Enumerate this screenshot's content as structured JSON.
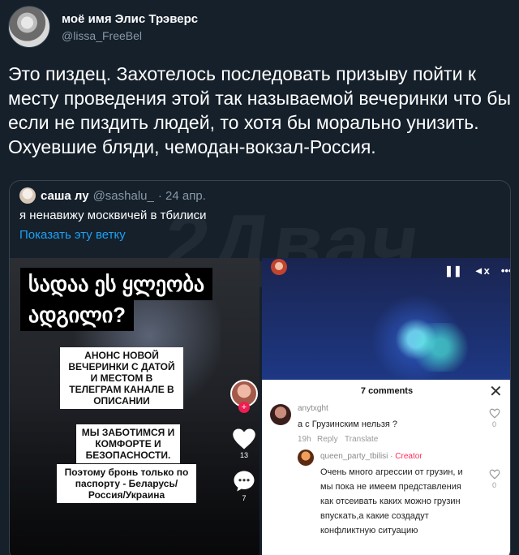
{
  "author": {
    "display_name": "моё имя Элис Трэверс",
    "handle": "@lissa_FreeBel"
  },
  "tweet": {
    "text": "Это пиздец. Захотелось последовать призыву пойти к месту проведения этой так называемой вечеринки что бы если не пиздить людей, то хотя бы морально унизить. Охуевшие бляди, чемодан-вокзал-Россия."
  },
  "quote": {
    "name": "саша лу",
    "handle": "@sashalu_",
    "date": "· 24 апр.",
    "text": "я ненавижу москвичей в тбилиси",
    "show_thread": "Показать эту ветку",
    "watermark": "2Двач"
  },
  "left_video": {
    "caption_line1": "სადაა ეს ყლეობა",
    "caption_line2": "ადგილი?",
    "label1": "АНОНС НОВОЙ ВЕЧЕРИНКИ С ДАТОЙ И МЕСТОМ В ТЕЛЕГРАМ КАНАЛЕ В ОПИСАНИИ",
    "label2": "МЫ ЗАБОТИМСЯ И КОМФОРТЕ И БЕЗОПАСНОСТИ.",
    "label3": "Поэтому бронь только по паспорту - Беларусь/ Россия/Украина",
    "likes": "13",
    "comments_count": "7"
  },
  "right_video": {
    "player_icons": [
      "❚❚",
      "◄x",
      "•••"
    ],
    "comments_title": "7 comments",
    "close": "✕",
    "comment1": {
      "user": "anytxght",
      "text": "а с Грузинским нельзя ?",
      "time": "19h",
      "reply": "Reply",
      "translate": "Translate",
      "likes": "0"
    },
    "comment2": {
      "user": "queen_party_tbilisi",
      "creator_label": "Creator",
      "lines": [
        "Очень много агрессии от грузин, и",
        "мы пока не имеем представления",
        "как отсеивать каких можно грузин",
        "впускать,а какие создадут",
        "конфликтную ситуацию"
      ],
      "likes": "0"
    }
  },
  "colors": {
    "background": "#15202b",
    "link": "#1da1f2",
    "muted": "#8899a6",
    "tiktok_red": "#fe2c55"
  }
}
